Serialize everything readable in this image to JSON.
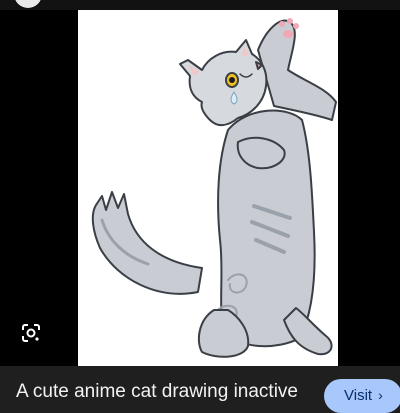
{
  "caption": {
    "title": "A cute anime cat drawing inactive"
  },
  "actions": {
    "visit_label": "Visit",
    "visit_chevron": "›"
  },
  "icons": {
    "lens": "google-lens-icon",
    "chevron": "chevron-right-icon"
  },
  "colors": {
    "page_background": "#1f1f1f",
    "viewer_background": "#000000",
    "visit_button": "#a8c7fa",
    "visit_text": "#062e6f",
    "cat_fur": "#c9cdd3",
    "cat_stripes": "#9aa1aa",
    "cat_outline": "#3a3f46"
  }
}
